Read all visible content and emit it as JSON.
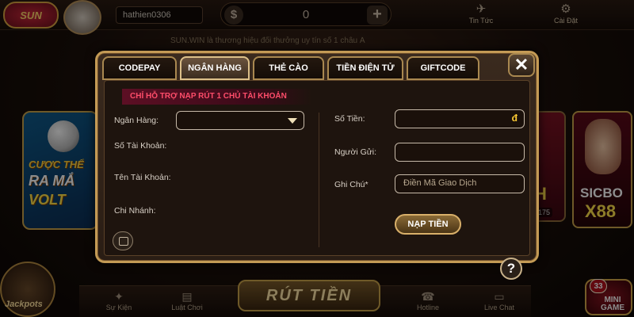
{
  "header": {
    "logo_text": "SUN",
    "username": "hathien0306",
    "currency_symbol": "$",
    "balance": "0",
    "add_symbol": "+",
    "news_label": "Tin Tức",
    "settings_label": "Cài Đặt"
  },
  "ticker": "SUN.WIN là thương hiệu đổi thưởng uy tín số 1 châu Á",
  "background": {
    "promo_line1": "CƯỢC THỂ",
    "promo_line2": "RA MẮ",
    "promo_line3": "VOLT",
    "card_mid_label": "H",
    "card_mid_number": "175",
    "card_right_line1": "SICBO",
    "card_right_line2": "X88",
    "jackpot_label": "Jackpots",
    "withdraw_banner": "RÚT TIỀN",
    "minigame_count": "33",
    "minigame_label": "MINI GAME"
  },
  "bottom_nav": {
    "items": [
      {
        "label": "Sự Kiện",
        "icon": "party-icon"
      },
      {
        "label": "Luật Chơi",
        "icon": "rules-icon"
      },
      {
        "label": "Hotline",
        "icon": "phone-icon"
      },
      {
        "label": "Live Chat",
        "icon": "chat-icon"
      }
    ]
  },
  "modal": {
    "tabs": [
      {
        "label": "CODEPAY",
        "active": false
      },
      {
        "label": "NGÂN HÀNG",
        "active": true
      },
      {
        "label": "THẺ CÀO",
        "active": false
      },
      {
        "label": "TIỀN ĐIỆN TỬ",
        "active": false
      },
      {
        "label": "GIFTCODE",
        "active": false
      }
    ],
    "close_symbol": "✕",
    "notice": "CHỈ HỖ TRỢ NẠP RÚT 1 CHỦ TÀI KHOẢN",
    "left": {
      "bank_label": "Ngân Hàng:",
      "bank_value": "",
      "account_number_label": "Số Tài Khoản:",
      "account_name_label": "Tên Tài Khoản:",
      "branch_label": "Chi Nhánh:"
    },
    "right": {
      "amount_label": "Số Tiền:",
      "amount_value": "",
      "amount_suffix": "đ",
      "sender_label": "Người Gửi:",
      "sender_value": "",
      "note_label": "Ghi Chú*",
      "note_placeholder": "Điền Mã Giao Dịch",
      "submit_label": "NẠP TIỀN"
    },
    "help_symbol": "?"
  }
}
